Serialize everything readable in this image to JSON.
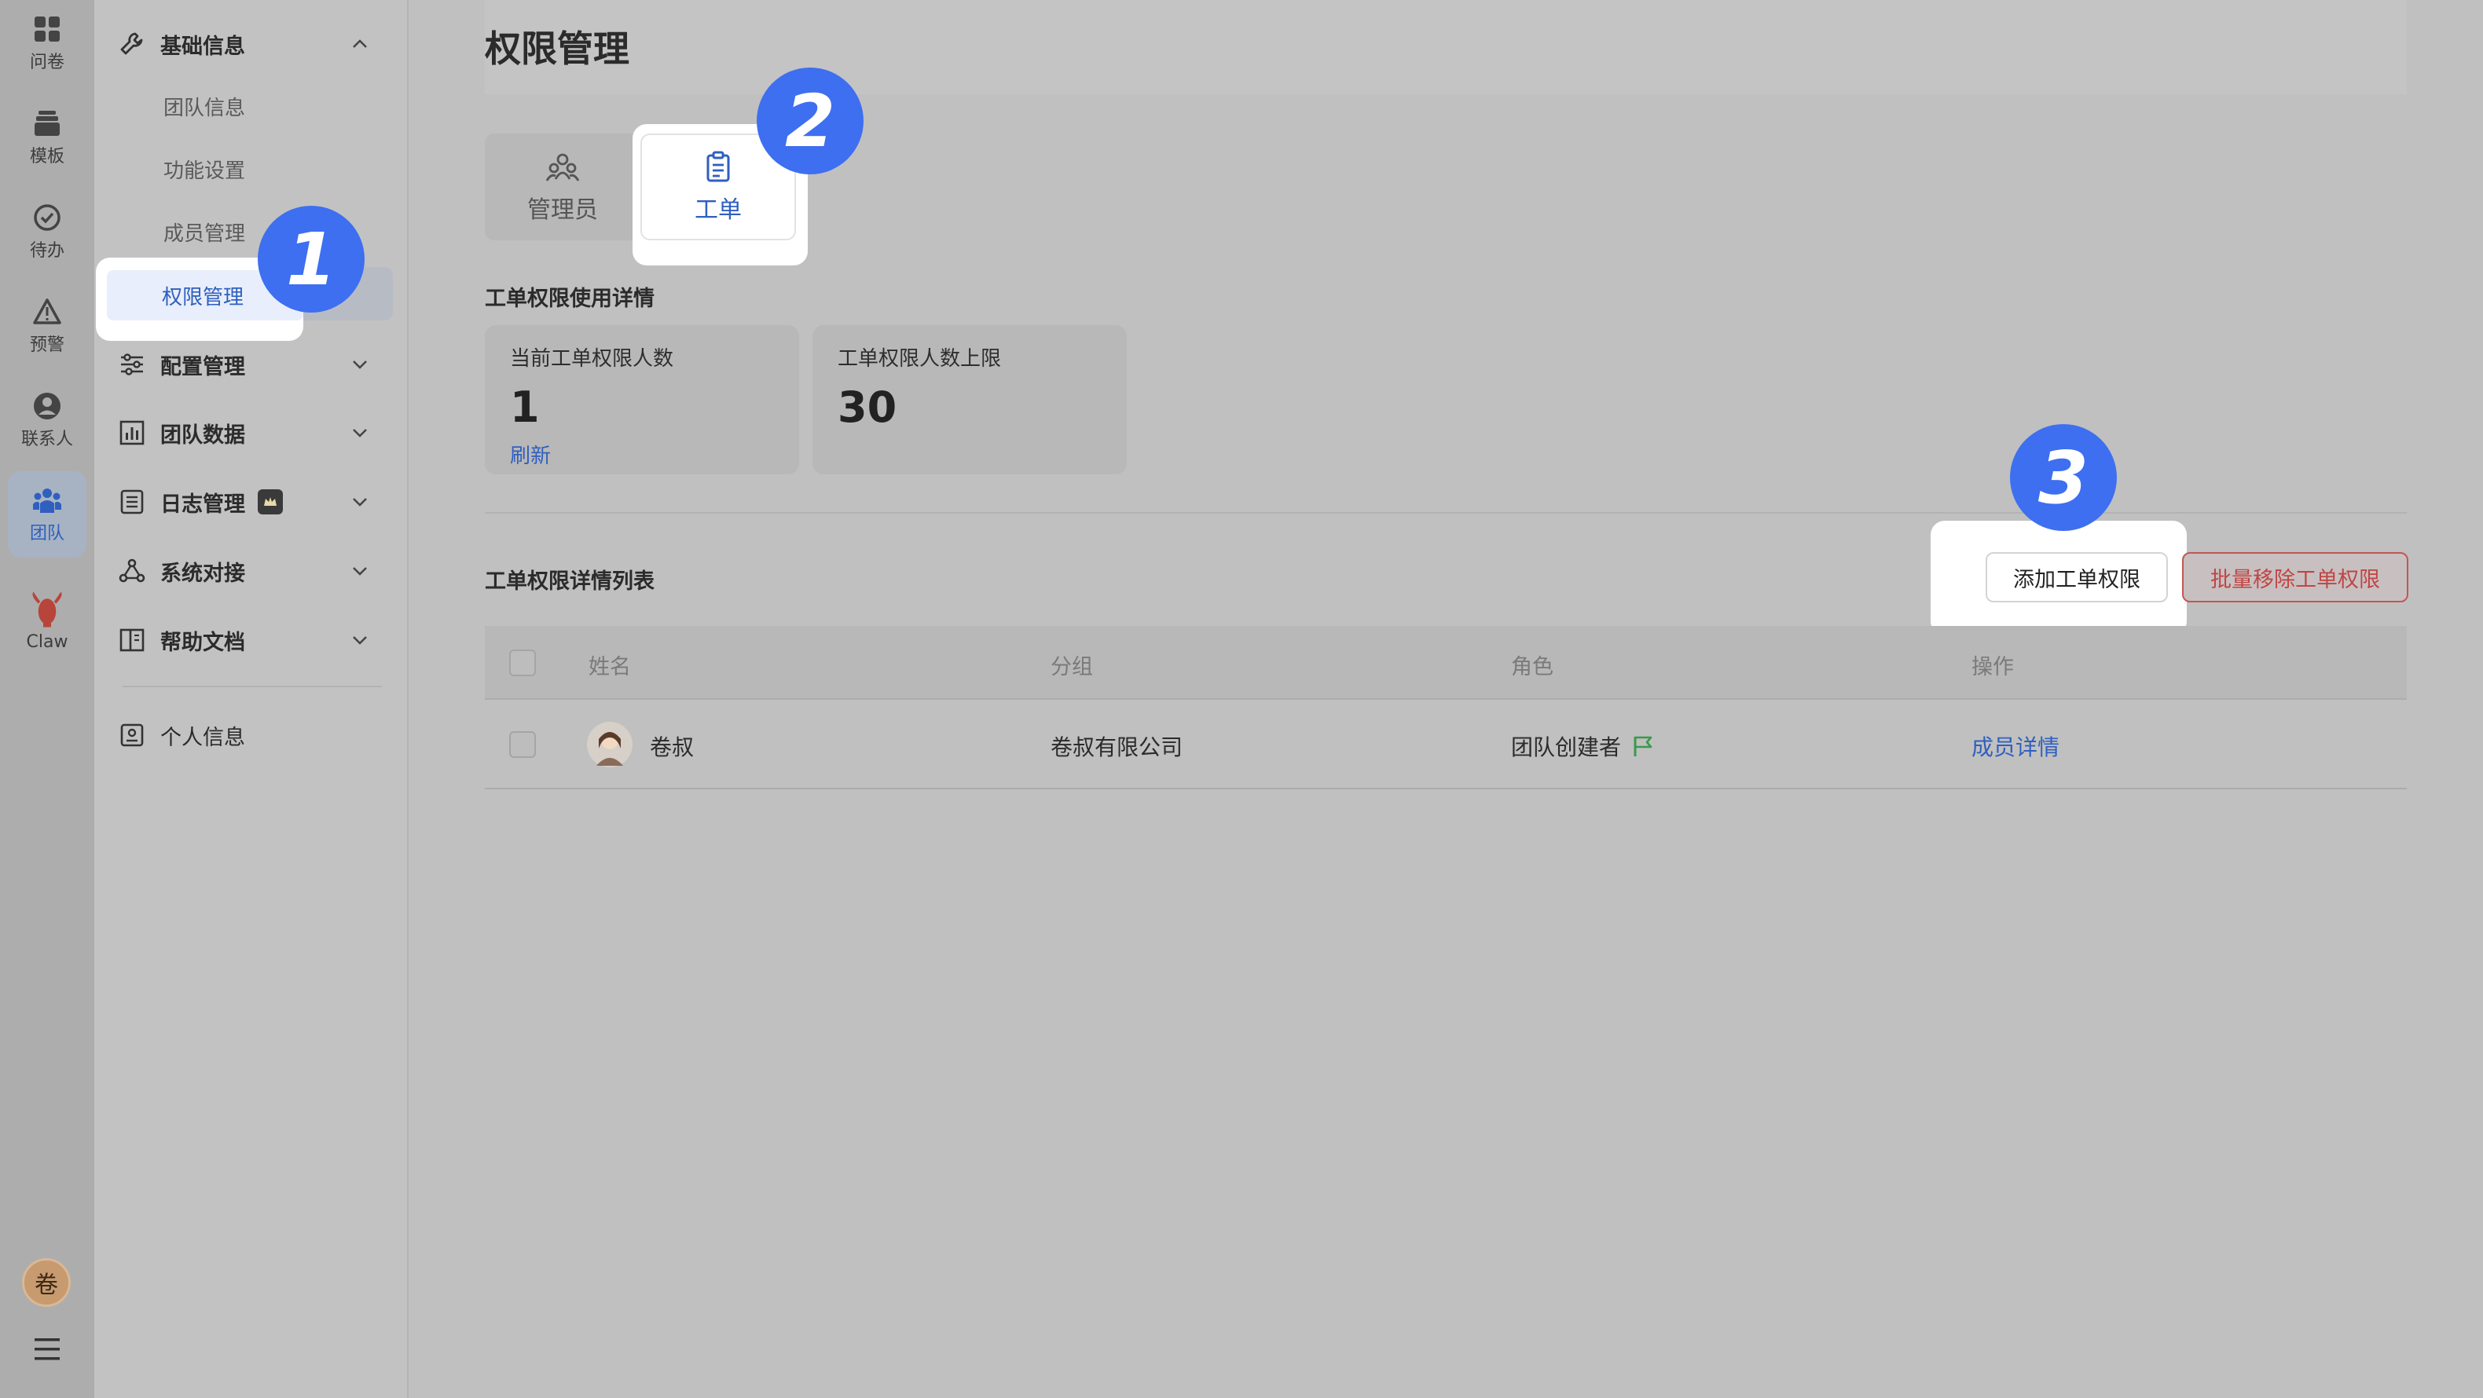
{
  "rail": {
    "items": [
      {
        "label": "问卷",
        "icon": "grid-icon"
      },
      {
        "label": "模板",
        "icon": "template-icon"
      },
      {
        "label": "待办",
        "icon": "check-circle-icon"
      },
      {
        "label": "预警",
        "icon": "warning-icon"
      },
      {
        "label": "联系人",
        "icon": "person-icon"
      },
      {
        "label": "团队",
        "icon": "team-icon"
      },
      {
        "label": "Claw",
        "icon": "lobster-icon"
      }
    ],
    "avatar_text": "卷"
  },
  "sidebar": {
    "group_basic": "基础信息",
    "sub_items": [
      "团队信息",
      "功能设置",
      "成员管理",
      "权限管理"
    ],
    "group_config": "配置管理",
    "group_data": "团队数据",
    "group_log": "日志管理",
    "group_system": "系统对接",
    "group_help": "帮助文档",
    "personal": "个人信息"
  },
  "main": {
    "title": "权限管理",
    "tabs": [
      {
        "label": "管理员",
        "icon": "admin-group-icon"
      },
      {
        "label": "工单",
        "icon": "clipboard-icon"
      }
    ],
    "usage_title": "工单权限使用详情",
    "stats": [
      {
        "label": "当前工单权限人数",
        "value": "1",
        "link": "刷新"
      },
      {
        "label": "工单权限人数上限",
        "value": "30"
      }
    ],
    "list_title": "工单权限详情列表",
    "add_button": "添加工单权限",
    "remove_button": "批量移除工单权限",
    "table": {
      "headers": [
        "姓名",
        "分组",
        "角色",
        "操作"
      ],
      "rows": [
        {
          "name": "卷叔",
          "group": "卷叔有限公司",
          "role": "团队创建者",
          "action": "成员详情"
        }
      ]
    }
  },
  "steps": [
    "1",
    "2",
    "3"
  ],
  "colors": {
    "accent": "#3d6ff0",
    "link": "#2f5fbf",
    "danger": "#c04545"
  }
}
